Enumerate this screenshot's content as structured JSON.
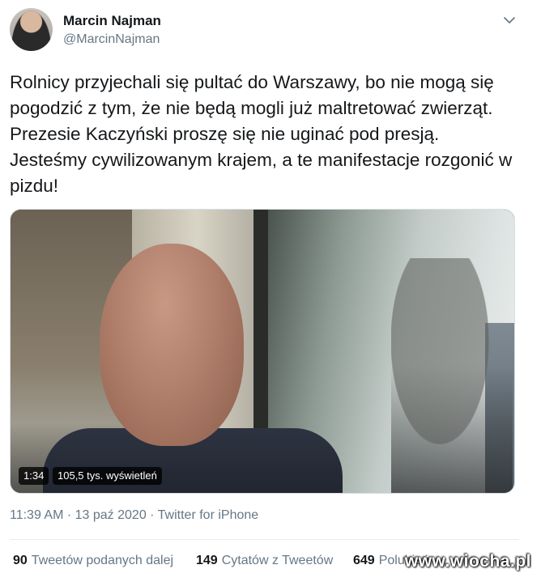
{
  "author": {
    "name": "Marcin Najman",
    "handle": "@MarcinNajman"
  },
  "tweet": {
    "text": "Rolnicy przyjechali się pultać do Warszawy, bo nie mogą się pogodzić z tym, że nie będą mogli już maltretować zwierząt. Prezesie Kaczyński proszę się nie uginać pod presją. Jesteśmy cywilizowanym krajem, a te manifestacje rozgonić w pizdu!"
  },
  "video": {
    "duration": "1:34",
    "views": "105,5 tys. wyświetleń"
  },
  "meta": {
    "time": "11:39 AM",
    "separator": " · ",
    "date": "13 paź 2020",
    "source": "Twitter for iPhone"
  },
  "stats": {
    "retweets_count": "90",
    "retweets_label": "Tweetów podanych dalej",
    "quotes_count": "149",
    "quotes_label": "Cytatów z Tweetów",
    "likes_count": "649",
    "likes_label": "Polubień"
  },
  "watermark": "www.wiocha.pl",
  "icons": {
    "menu": "chevron-down-icon"
  },
  "colors": {
    "text_primary": "#14171a",
    "text_secondary": "#657786"
  }
}
